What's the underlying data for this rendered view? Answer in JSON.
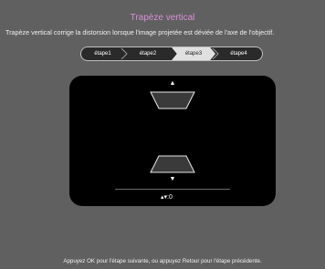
{
  "header": {
    "title": "Trapèze vertical",
    "description": "Trapèze vertical corrige la distorsion lorsque l'image projetée est déviée de l'axe de l'objectif."
  },
  "steps": {
    "items": [
      "étape1",
      "étape2",
      "étape3",
      "étape4"
    ],
    "active_index": 2
  },
  "adjust": {
    "up_icon": "triangle-up-icon",
    "down_icon": "triangle-down-icon",
    "value_icon": "up-down-arrows-icon",
    "value": "0",
    "value_prefix": "▴▾:"
  },
  "footer": {
    "hint": "Appuyez OK pour l'étape suivante, ou appuyez Retour pour l'étape précédente."
  },
  "colors": {
    "background": "#606060",
    "title": "#d890d8",
    "panel": "#000000",
    "trapezoid_fill": "#3a3a3a",
    "trapezoid_stroke": "#e8e8e8"
  }
}
